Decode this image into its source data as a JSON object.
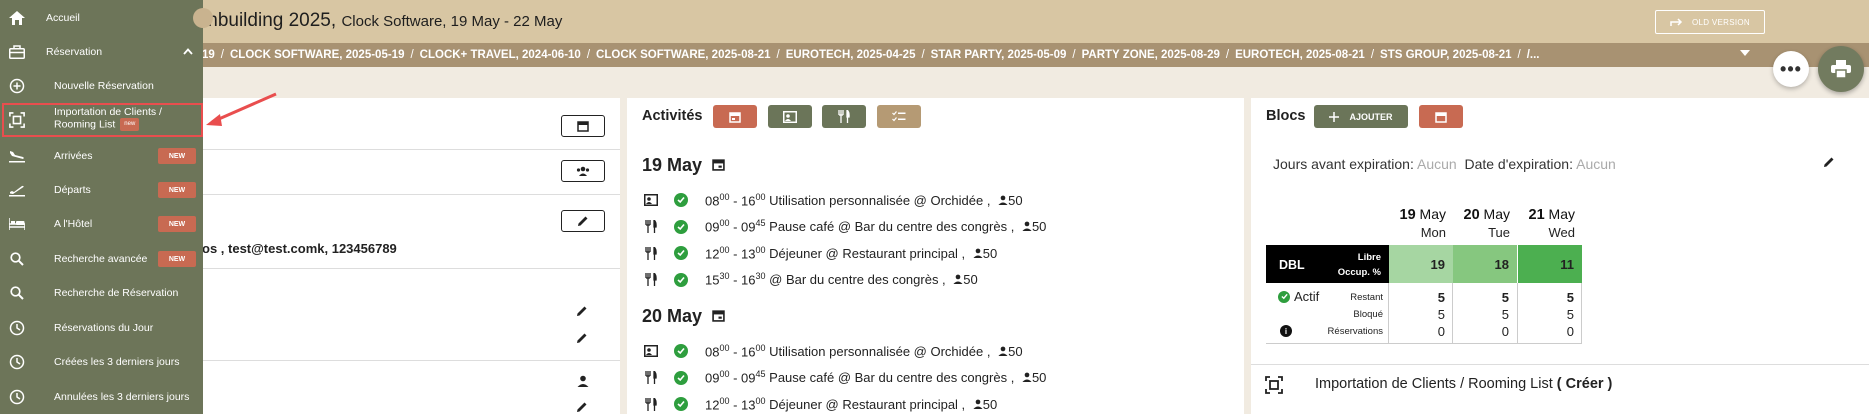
{
  "header": {
    "title": "mbuilding 2025,",
    "subtitle": "Clock Software, 19 May - 22 May",
    "old_version_label": "OLD VERSION"
  },
  "breadcrumbs": [
    "19",
    "CLOCK SOFTWARE, 2025-05-19",
    "CLOCK+ TRAVEL, 2024-06-10",
    "CLOCK SOFTWARE, 2025-08-21",
    "EUROTECH, 2025-04-25",
    "STAR PARTY, 2025-05-09",
    "PARTY ZONE, 2025-08-29",
    "EUROTECH, 2025-08-21",
    "STS GROUP, 2025-08-21",
    "/..."
  ],
  "left_panel": {
    "contact_text": "os , test@test.comk, 123456789"
  },
  "activities": {
    "title": "Activités",
    "buttons": [
      {
        "icon": "calendar-icon",
        "color": "#c86a52"
      },
      {
        "icon": "badge-icon",
        "color": "#6b7559"
      },
      {
        "icon": "restaurant-icon",
        "color": "#6b7559"
      },
      {
        "icon": "checklist-icon",
        "color": "#b59a74"
      }
    ],
    "days": [
      {
        "label": "19 May",
        "rows": [
          {
            "type": "badge",
            "start_h": "08",
            "start_m": "00",
            "end_h": "16",
            "end_m": "00",
            "text": "Utilisation personnalisée @ Orchidée ,",
            "pax": "50"
          },
          {
            "type": "food",
            "start_h": "09",
            "start_m": "00",
            "end_h": "09",
            "end_m": "45",
            "text": "Pause café @ Bar du centre des congrès ,",
            "pax": "50"
          },
          {
            "type": "food",
            "start_h": "12",
            "start_m": "00",
            "end_h": "13",
            "end_m": "00",
            "text": "Déjeuner @ Restaurant principal ,",
            "pax": "50"
          },
          {
            "type": "food",
            "start_h": "15",
            "start_m": "30",
            "end_h": "16",
            "end_m": "30",
            "text": "@ Bar du centre des congrès ,",
            "pax": "50"
          }
        ]
      },
      {
        "label": "20 May",
        "rows": [
          {
            "type": "badge",
            "start_h": "08",
            "start_m": "00",
            "end_h": "16",
            "end_m": "00",
            "text": "Utilisation personnalisée @ Orchidée ,",
            "pax": "50"
          },
          {
            "type": "food",
            "start_h": "09",
            "start_m": "00",
            "end_h": "09",
            "end_m": "45",
            "text": "Pause café @ Bar du centre des congrès ,",
            "pax": "50"
          },
          {
            "type": "food",
            "start_h": "12",
            "start_m": "00",
            "end_h": "13",
            "end_m": "00",
            "text": "Déjeuner @ Restaurant principal ,",
            "pax": "50"
          }
        ]
      }
    ]
  },
  "blocs": {
    "title": "Blocs",
    "add_label": "AJOUTER",
    "expiry_days_label": "Jours avant expiration:",
    "expiry_days_value": "Aucun",
    "expiry_date_label": "Date d'expiration:",
    "expiry_date_value": "Aucun",
    "days": [
      {
        "num": "19",
        "month": "May",
        "weekday": "Mon"
      },
      {
        "num": "20",
        "month": "May",
        "weekday": "Tue"
      },
      {
        "num": "21",
        "month": "May",
        "weekday": "Wed"
      }
    ],
    "room_code": "DBL",
    "libre_label": "Libre",
    "occup_label": "Occup. %",
    "free_values": [
      "19",
      "18",
      "11"
    ],
    "free_colors": [
      "#a6d6a2",
      "#86c77f",
      "#4caf50"
    ],
    "status_label": "Actif",
    "stat_labels": [
      "Restant",
      "Bloqué",
      "Réservations"
    ],
    "restant": [
      "5",
      "5",
      "5"
    ],
    "bloque": [
      "5",
      "5",
      "5"
    ],
    "reservations": [
      "0",
      "0",
      "0"
    ],
    "import_label": "Importation de Clients / Rooming List",
    "create_label": "( Créer )"
  },
  "sidebar": {
    "items": [
      {
        "label": "Accueil",
        "icon": "home-icon"
      },
      {
        "label": "Réservation",
        "icon": "briefcase-icon"
      },
      {
        "label": "Nouvelle Réservation",
        "icon": "add-circle-icon"
      },
      {
        "label": "Importation de Clients /",
        "label2": "Rooming List",
        "badge": "new",
        "icon": "import-icon"
      },
      {
        "label": "Arrivées",
        "badge": "NEW",
        "icon": "plane-arrival-icon"
      },
      {
        "label": "Départs",
        "badge": "NEW",
        "icon": "plane-departure-icon"
      },
      {
        "label": "A l'Hôtel",
        "badge": "NEW",
        "icon": "bed-icon"
      },
      {
        "label": "Recherche avancée",
        "badge": "NEW",
        "icon": "search-icon"
      },
      {
        "label": "Recherche de Réservation",
        "icon": "search-icon"
      },
      {
        "label": "Réservations du Jour",
        "icon": "clock-icon"
      },
      {
        "label": "Créées les 3 derniers jours",
        "icon": "clock-icon"
      },
      {
        "label": "Annulées les 3 derniers jours",
        "icon": "clock-icon"
      }
    ]
  }
}
